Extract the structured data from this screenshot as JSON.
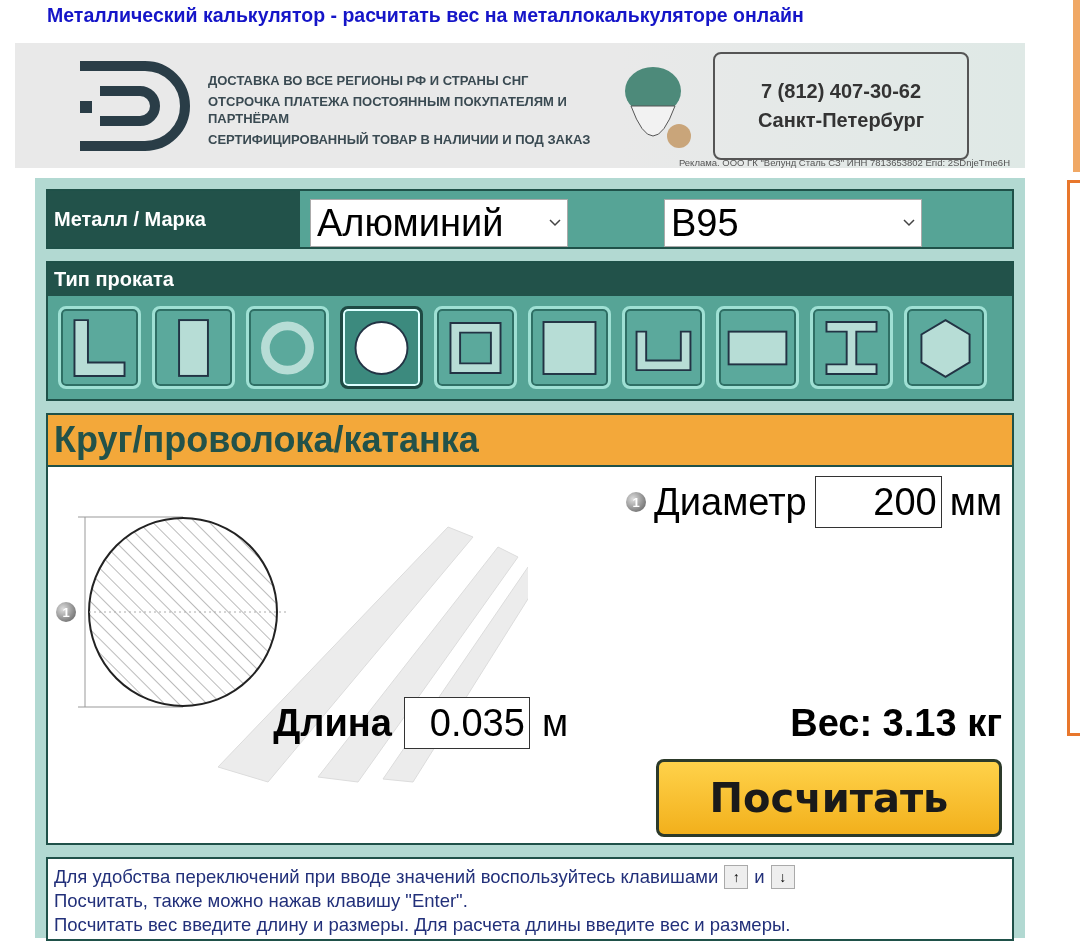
{
  "page_title": "Металлический калькулятор - расчитать вес на металлокалькуляторе онлайн",
  "ad": {
    "lines": [
      "ДОСТАВКА ВО ВСЕ РЕГИОНЫ РФ И СТРАНЫ СНГ",
      "ОТСРОЧКА ПЛАТЕЖА ПОСТОЯННЫМ ПОКУПАТЕЛЯМ И ПАРТНЁРАМ",
      "СЕРТИФИЦИРОВАННЫЙ ТОВАР В НАЛИЧИИ И ПОД ЗАКАЗ"
    ],
    "phone": "7 (812) 407-30-62",
    "city": "Санкт-Петербург",
    "disclaimer": "Реклама. ООО ГК \"Велунд Сталь СЗ\" ИНН 7813653802 Erid: 2SDnjeTme6H"
  },
  "metal": {
    "label": "Металл / Марка",
    "metal_value": "Алюминий",
    "grade_value": "В95"
  },
  "profile_types": {
    "title": "Тип проката",
    "items": [
      {
        "kind": "angle",
        "selected": false
      },
      {
        "kind": "strip",
        "selected": false
      },
      {
        "kind": "pipe",
        "selected": false
      },
      {
        "kind": "round",
        "selected": true
      },
      {
        "kind": "square-tube",
        "selected": false
      },
      {
        "kind": "square",
        "selected": false
      },
      {
        "kind": "channel",
        "selected": false
      },
      {
        "kind": "sheet",
        "selected": false
      },
      {
        "kind": "beam",
        "selected": false
      },
      {
        "kind": "hexagon",
        "selected": false
      }
    ]
  },
  "section": {
    "title": "Круг/проволока/катанка",
    "drawing_marker": "1",
    "diameter": {
      "marker": "1",
      "label": "Диаметр",
      "value": "200",
      "unit": "мм"
    },
    "length": {
      "label": "Длина",
      "value": "0.035",
      "unit": "м"
    },
    "weight": "Вес: 3.13 кг",
    "button": "Посчитать"
  },
  "help": {
    "line1": "Для удобства переключений при вводе значений воспользуйтесь клавишами",
    "key_up": "↑",
    "conjunction": "и",
    "key_down": "↓",
    "line2": "Посчитать, также можно нажав клавишу \"Enter\".",
    "line3": "Посчитать вес введите длину и размеры. Для расчета длины введите вес и размеры."
  }
}
